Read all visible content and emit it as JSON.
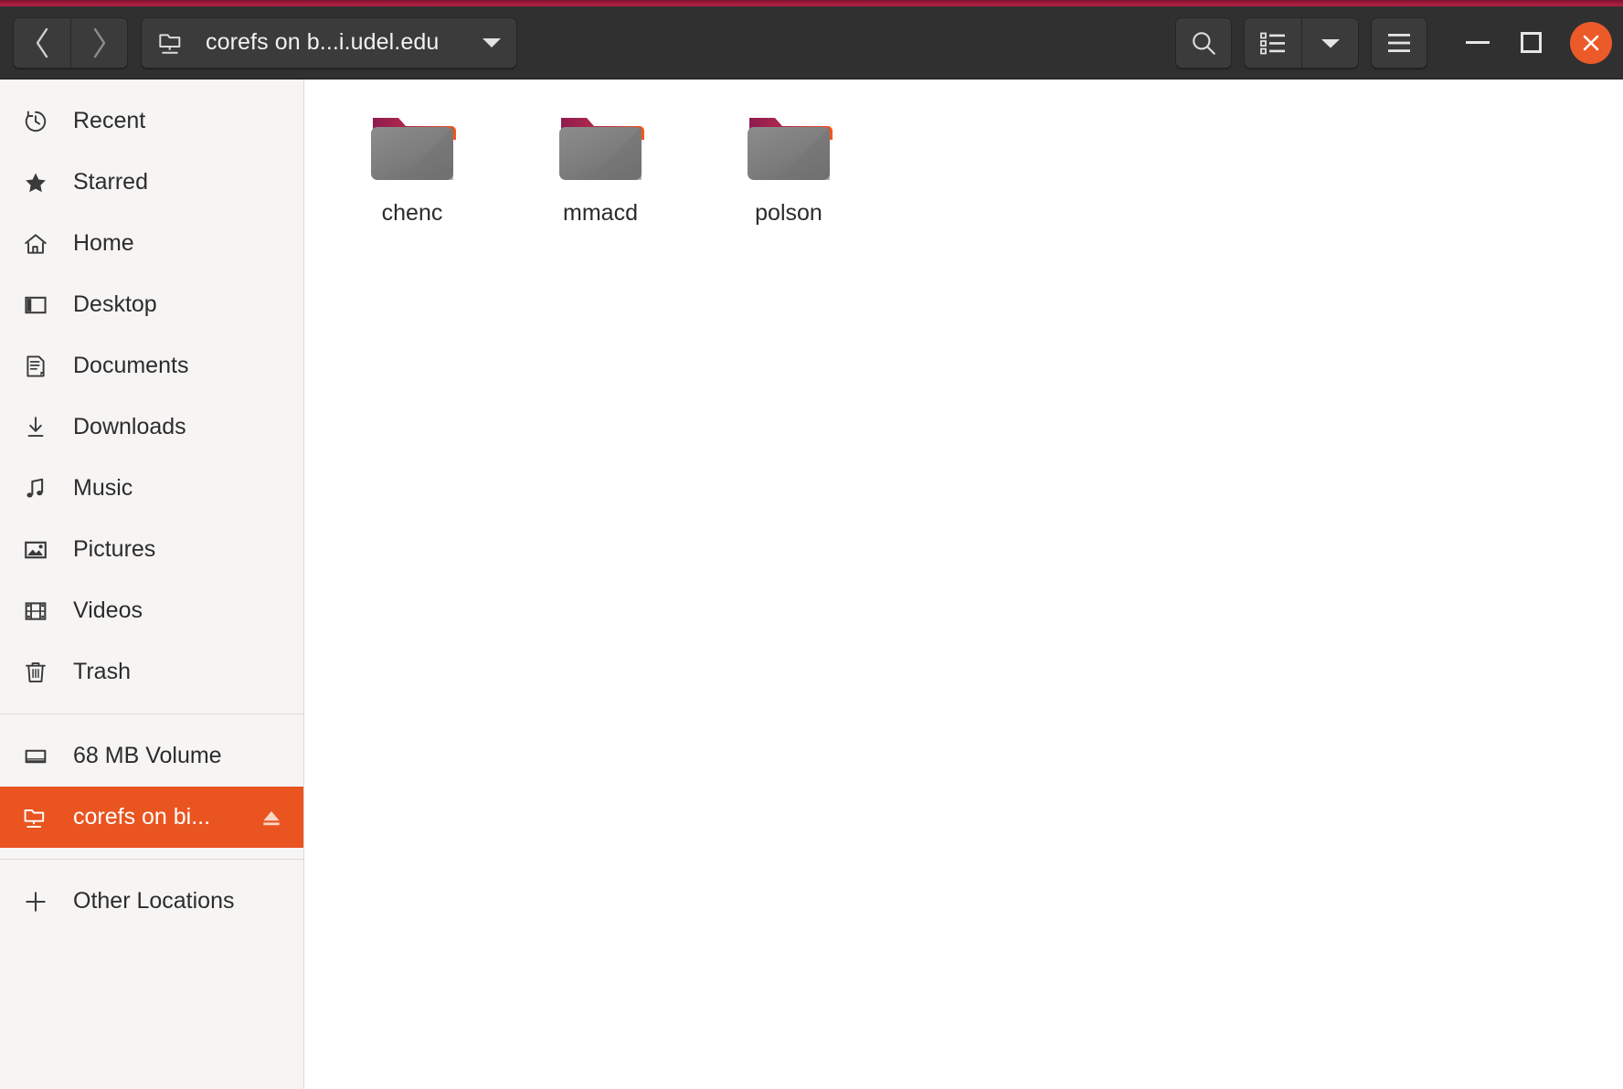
{
  "window": {
    "accent_color": "#9c1b3c",
    "headerbar_color": "#303030",
    "selection_color": "#e95420"
  },
  "header": {
    "back_label": "Back",
    "forward_label": "Forward",
    "path_label": "corefs on b...i.udel.edu",
    "path_icon": "network-folder-icon",
    "path_caret_icon": "chevron-down-icon",
    "search_label": "Search",
    "view_list_label": "List view",
    "view_options_label": "View options",
    "menu_label": "Main menu",
    "minimize_label": "Minimize",
    "maximize_label": "Maximize",
    "close_label": "Close"
  },
  "sidebar": {
    "items": [
      {
        "label": "Recent",
        "icon": "clock-icon",
        "selected": false,
        "eject": false
      },
      {
        "label": "Starred",
        "icon": "star-icon",
        "selected": false,
        "eject": false
      },
      {
        "label": "Home",
        "icon": "home-icon",
        "selected": false,
        "eject": false
      },
      {
        "label": "Desktop",
        "icon": "desktop-icon",
        "selected": false,
        "eject": false
      },
      {
        "label": "Documents",
        "icon": "document-icon",
        "selected": false,
        "eject": false
      },
      {
        "label": "Downloads",
        "icon": "download-icon",
        "selected": false,
        "eject": false
      },
      {
        "label": "Music",
        "icon": "music-note-icon",
        "selected": false,
        "eject": false
      },
      {
        "label": "Pictures",
        "icon": "picture-icon",
        "selected": false,
        "eject": false
      },
      {
        "label": "Videos",
        "icon": "film-icon",
        "selected": false,
        "eject": false
      },
      {
        "label": "Trash",
        "icon": "trash-icon",
        "selected": false,
        "eject": false
      }
    ],
    "devices": [
      {
        "label": "68 MB Volume",
        "icon": "drive-icon",
        "selected": false,
        "eject": false
      },
      {
        "label": "corefs on bi...",
        "icon": "network-folder-icon",
        "selected": true,
        "eject": true
      }
    ],
    "other": [
      {
        "label": "Other Locations",
        "icon": "plus-icon",
        "selected": false,
        "eject": false
      }
    ]
  },
  "content": {
    "files": [
      {
        "name": "chenc",
        "type": "folder"
      },
      {
        "name": "mmacd",
        "type": "folder"
      },
      {
        "name": "polson",
        "type": "folder"
      }
    ]
  }
}
